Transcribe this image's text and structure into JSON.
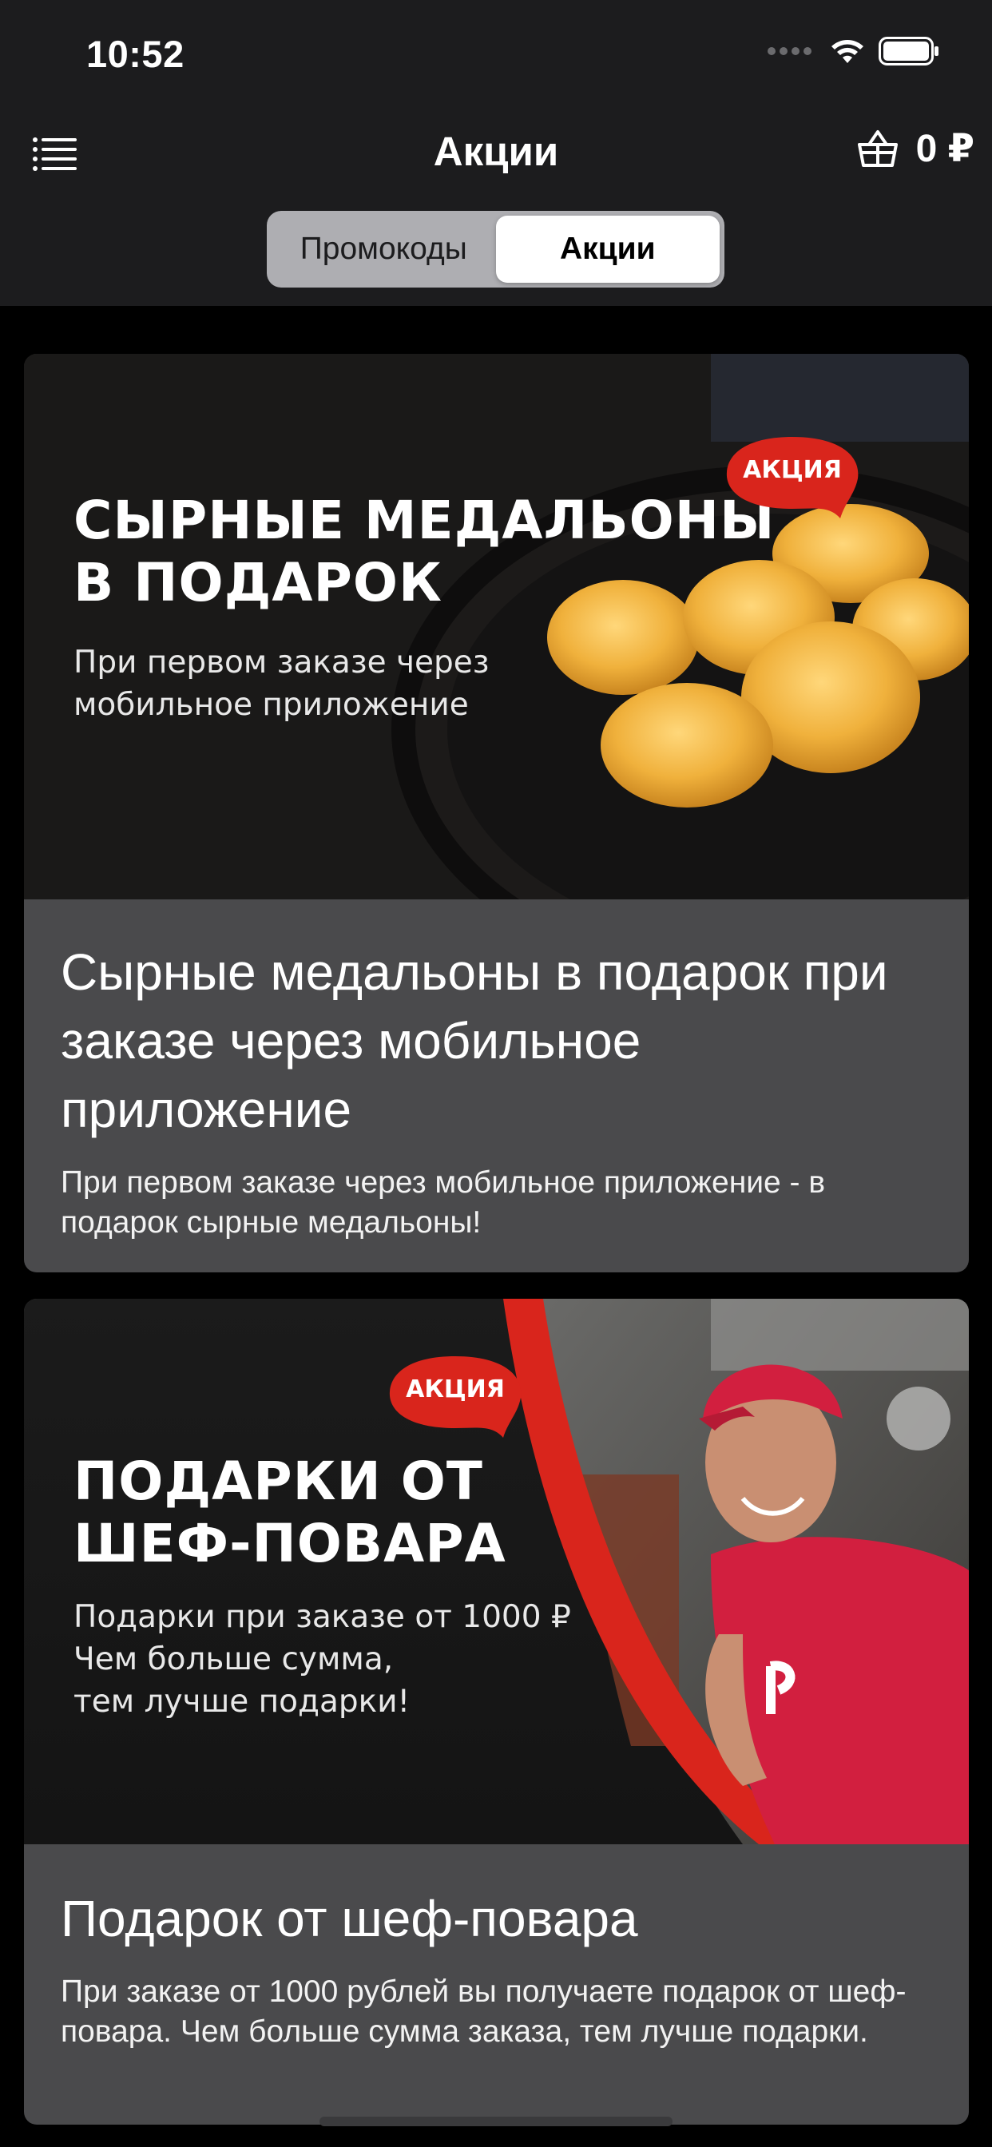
{
  "status_bar": {
    "time": "10:52"
  },
  "nav": {
    "title": "Акции",
    "cart_total": "0 ₽"
  },
  "segmented": {
    "items": [
      "Промокоды",
      "Акции"
    ],
    "selected": "Акции"
  },
  "promos": [
    {
      "banner": {
        "badge": "АКЦИЯ",
        "heading_line1": "СЫРНЫЕ МЕДАЛЬОНЫ",
        "heading_line2": "В ПОДАРОК",
        "sub_line1": "При первом заказе через",
        "sub_line2": "мобильное приложение"
      },
      "title": "Сырные медальоны в подарок при заказе через мобильное приложение",
      "description": "При первом заказе через мобильное приложение - в подарок сырные медальоны!"
    },
    {
      "banner": {
        "badge": "АКЦИЯ",
        "heading_line1": "ПОДАРКИ ОТ",
        "heading_line2": "ШЕФ-ПОВАРА",
        "sub_line1": "Подарки при заказе от 1000 ₽",
        "sub_line2": "Чем больше сумма,",
        "sub_line3": "тем лучше подарки!"
      },
      "title": "Подарок от шеф-повара",
      "description": "При заказе от 1000 рублей вы получаете подарок от шеф-повара. Чем больше сумма заказа, тем лучше подарки."
    }
  ],
  "colors": {
    "header_bg": "#1c1c1e",
    "card_bg": "#4a4a4c",
    "badge_red": "#d9251c"
  }
}
